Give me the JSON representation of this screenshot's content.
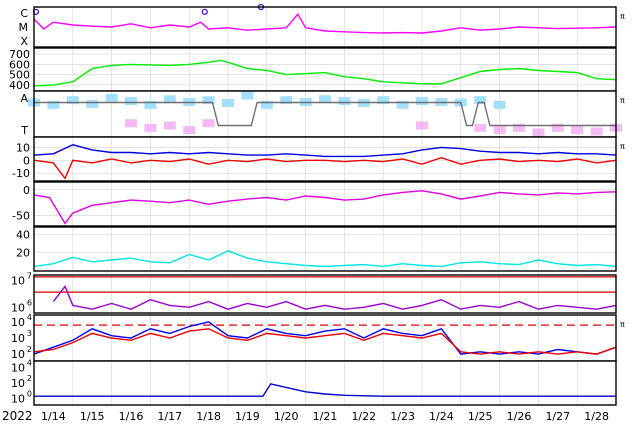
{
  "chart_data": [
    {
      "type": "line",
      "panel": "xray-flux",
      "y_tick_labels": [
        "X",
        "M",
        "C"
      ],
      "right_mark": "π",
      "grid": true,
      "series": [
        {
          "color": "#ff00ff",
          "x": [
            0,
            0.25,
            0.5,
            1,
            1.5,
            2,
            2.5,
            3,
            3.5,
            4,
            4.3,
            4.5,
            5,
            5.5,
            6,
            6.5,
            6.8,
            7,
            7.5,
            8,
            8.5,
            9,
            9.5,
            10,
            10.5,
            11,
            11.5,
            12,
            12.5,
            13,
            13.5,
            14,
            14.5,
            15
          ],
          "y": [
            0.7,
            0.45,
            0.62,
            0.55,
            0.52,
            0.5,
            0.58,
            0.48,
            0.55,
            0.5,
            0.62,
            0.45,
            0.48,
            0.42,
            0.45,
            0.48,
            0.82,
            0.48,
            0.4,
            0.38,
            0.36,
            0.35,
            0.36,
            0.35,
            0.4,
            0.48,
            0.42,
            0.45,
            0.5,
            0.48,
            0.46,
            0.47,
            0.48,
            0.5
          ]
        }
      ],
      "flare_markers": [
        {
          "x": 0.05,
          "y": 0.88
        },
        {
          "x": 4.4,
          "y": 0.88
        },
        {
          "x": 5.85,
          "y": 1.0
        }
      ]
    },
    {
      "type": "line",
      "panel": "solar-wind-speed",
      "y_ticks": [
        400,
        500,
        600,
        700
      ],
      "ylim": [
        340,
        760
      ],
      "grid": true,
      "series": [
        {
          "color": "#00ee00",
          "x": [
            0,
            0.5,
            1,
            1.5,
            2,
            2.5,
            3,
            3.5,
            4,
            4.5,
            4.8,
            5,
            5.5,
            6,
            6.5,
            7,
            7.5,
            8,
            8.5,
            9,
            9.5,
            10,
            10.5,
            11,
            11.5,
            12,
            12.5,
            13,
            13.5,
            14,
            14.5,
            15
          ],
          "y": [
            390,
            400,
            430,
            560,
            590,
            600,
            595,
            590,
            600,
            620,
            640,
            620,
            560,
            540,
            500,
            510,
            520,
            480,
            460,
            430,
            420,
            410,
            410,
            470,
            530,
            550,
            560,
            540,
            530,
            520,
            460,
            450
          ]
        }
      ]
    },
    {
      "type": "scatter",
      "panel": "magnetic-polarity",
      "y_tick_labels": [
        "T",
        "A"
      ],
      "right_mark": "π",
      "grid": true,
      "series": [
        {
          "color": "#99ddff",
          "x": [
            0,
            0.5,
            1,
            1.5,
            2,
            2.5,
            3,
            3.5,
            4,
            4.5,
            5,
            5.5,
            6,
            6.5,
            7,
            7.5,
            8,
            8.5,
            9,
            9.5,
            10,
            10.5,
            11,
            11.5,
            12
          ],
          "y": [
            0.75,
            0.7,
            0.8,
            0.72,
            0.85,
            0.78,
            0.7,
            0.82,
            0.76,
            0.8,
            0.74,
            0.9,
            0.7,
            0.8,
            0.76,
            0.82,
            0.78,
            0.74,
            0.8,
            0.7,
            0.78,
            0.76,
            0.75,
            0.8,
            0.7
          ]
        },
        {
          "color": "#f2b3f2",
          "x": [
            2.5,
            3,
            3.5,
            4,
            4.5,
            10,
            11.5,
            12,
            12.5,
            13,
            13.5,
            14,
            14.5,
            15
          ],
          "y": [
            0.3,
            0.2,
            0.25,
            0.15,
            0.3,
            0.25,
            0.2,
            0.15,
            0.2,
            0.1,
            0.2,
            0.15,
            0.12,
            0.2
          ]
        },
        {
          "color": "#707070",
          "x": [
            0,
            4.6,
            4.75,
            5.6,
            5.75,
            11,
            11.15,
            11.3,
            11.45,
            11.6,
            11.75,
            15
          ],
          "y": [
            0.75,
            0.75,
            0.25,
            0.25,
            0.75,
            0.75,
            0.25,
            0.25,
            0.75,
            0.75,
            0.25,
            0.25
          ]
        }
      ]
    },
    {
      "type": "line",
      "panel": "imf-components",
      "y_ticks": [
        -10,
        0,
        10
      ],
      "ylim": [
        -16,
        18
      ],
      "right_mark": "π",
      "grid": true,
      "series": [
        {
          "color": "#0000dd",
          "x": [
            0,
            0.5,
            1,
            1.5,
            2,
            2.5,
            3,
            3.5,
            4,
            4.5,
            5,
            5.5,
            6,
            6.5,
            7,
            7.5,
            8,
            8.5,
            9,
            9.5,
            10,
            10.5,
            11,
            11.5,
            12,
            12.5,
            13,
            13.5,
            14,
            14.5,
            15
          ],
          "y": [
            4,
            5,
            12,
            8,
            6,
            6,
            5,
            6,
            5,
            6,
            5,
            4,
            4,
            5,
            4,
            3,
            3,
            3,
            4,
            5,
            8,
            10,
            9,
            7,
            6,
            6,
            5,
            6,
            5,
            5,
            4
          ]
        },
        {
          "color": "#ee0000",
          "x": [
            0,
            0.5,
            0.8,
            1,
            1.5,
            2,
            2.5,
            3,
            3.5,
            4,
            4.5,
            5,
            5.5,
            6,
            6.5,
            7,
            7.5,
            8,
            8.5,
            9,
            9.5,
            10,
            10.5,
            11,
            11.5,
            12,
            12.5,
            13,
            13.5,
            14,
            14.5,
            15
          ],
          "y": [
            0,
            -2,
            -14,
            0,
            -2,
            1,
            -2,
            0,
            -1,
            1,
            -3,
            0,
            -1,
            1,
            -1,
            0,
            0,
            -1,
            0,
            -1,
            1,
            -3,
            2,
            -3,
            0,
            1,
            -1,
            0,
            -1,
            1,
            -2,
            0
          ]
        }
      ]
    },
    {
      "type": "line",
      "panel": "dst-index",
      "y_ticks": [
        -50,
        0
      ],
      "ylim": [
        -70,
        15
      ],
      "grid": true,
      "series": [
        {
          "color": "#dd00dd",
          "x": [
            0,
            0.4,
            0.8,
            1,
            1.5,
            2,
            2.5,
            3,
            3.5,
            4,
            4.5,
            5,
            5.5,
            6,
            6.5,
            7,
            7.5,
            8,
            8.5,
            9,
            9.5,
            10,
            10.5,
            11,
            11.5,
            12,
            12.5,
            13,
            13.5,
            14,
            14.5,
            15
          ],
          "y": [
            -10,
            -15,
            -65,
            -45,
            -30,
            -25,
            -20,
            -22,
            -25,
            -20,
            -28,
            -22,
            -18,
            -15,
            -20,
            -12,
            -15,
            -20,
            -18,
            -10,
            -5,
            -2,
            -8,
            -18,
            -12,
            -5,
            -8,
            -10,
            -6,
            -8,
            -5,
            -4
          ]
        }
      ]
    },
    {
      "type": "line",
      "panel": "kp-index",
      "y_ticks": [
        20,
        40
      ],
      "ylim": [
        0,
        48
      ],
      "grid": true,
      "series": [
        {
          "color": "#00e5e5",
          "x": [
            0,
            0.5,
            1,
            1.5,
            2,
            2.5,
            3,
            3.5,
            4,
            4.5,
            5,
            5.5,
            6,
            6.5,
            7,
            7.5,
            8,
            8.5,
            9,
            9.5,
            10,
            10.5,
            11,
            11.5,
            12,
            12.5,
            13,
            13.5,
            14,
            14.5,
            15
          ],
          "y": [
            5,
            8,
            15,
            10,
            12,
            14,
            10,
            9,
            18,
            12,
            22,
            14,
            10,
            8,
            6,
            5,
            6,
            7,
            5,
            8,
            6,
            5,
            9,
            10,
            8,
            7,
            12,
            8,
            6,
            7,
            5
          ]
        }
      ]
    },
    {
      "type": "line",
      "panel": "electron-flux",
      "y_tick_labels": [
        "10",
        "10"
      ],
      "y_tick_exponents": [
        "6",
        "7"
      ],
      "grid": true,
      "threshold_lines": [
        {
          "color": "#cc0000",
          "y": 0.55
        },
        {
          "color": "#cc0000",
          "y": 0.95
        }
      ],
      "series": [
        {
          "color": "#9900cc",
          "x": [
            0.5,
            0.8,
            1,
            1.5,
            2,
            2.5,
            3,
            3.5,
            4,
            4.5,
            5,
            5.5,
            6,
            6.5,
            7,
            7.5,
            8,
            8.5,
            9,
            9.5,
            10,
            10.5,
            11,
            11.5,
            12,
            12.5,
            13,
            13.5,
            14,
            14.5,
            15
          ],
          "y": [
            0.3,
            0.7,
            0.2,
            0.1,
            0.25,
            0.1,
            0.35,
            0.2,
            0.15,
            0.3,
            0.1,
            0.25,
            0.15,
            0.3,
            0.1,
            0.2,
            0.1,
            0.15,
            0.25,
            0.1,
            0.2,
            0.35,
            0.1,
            0.2,
            0.15,
            0.3,
            0.1,
            0.2,
            0.15,
            0.1,
            0.2
          ]
        }
      ]
    },
    {
      "type": "line",
      "panel": "proton-flux",
      "y_tick_labels": [
        "10",
        "10",
        "10"
      ],
      "y_tick_exponents": [
        "2",
        "3",
        "4"
      ],
      "right_mark": "π",
      "grid": true,
      "threshold_lines": [
        {
          "color": "#dd0000",
          "y": 0.78,
          "dashed": true
        }
      ],
      "series": [
        {
          "color": "#0000ee",
          "x": [
            0,
            0.5,
            1,
            1.5,
            2,
            2.5,
            3,
            3.5,
            4,
            4.5,
            5,
            5.5,
            6,
            6.5,
            7,
            7.5,
            8,
            8.5,
            9,
            9.5,
            10,
            10.5,
            11,
            11.5,
            12,
            12.5,
            13,
            13.5,
            14,
            14.5,
            15
          ],
          "y": [
            0.15,
            0.3,
            0.45,
            0.7,
            0.55,
            0.5,
            0.7,
            0.6,
            0.75,
            0.85,
            0.55,
            0.5,
            0.7,
            0.6,
            0.55,
            0.65,
            0.7,
            0.5,
            0.7,
            0.6,
            0.55,
            0.7,
            0.15,
            0.2,
            0.15,
            0.2,
            0.15,
            0.25,
            0.2,
            0.15,
            0.3
          ]
        },
        {
          "color": "#ee0000",
          "x": [
            0,
            0.5,
            1,
            1.5,
            2,
            2.5,
            3,
            3.5,
            4,
            4.5,
            5,
            5.5,
            6,
            6.5,
            7,
            7.5,
            8,
            8.5,
            9,
            9.5,
            10,
            10.5,
            11,
            11.5,
            12,
            12.5,
            13,
            13.5,
            14,
            14.5,
            15
          ],
          "y": [
            0.2,
            0.25,
            0.4,
            0.6,
            0.5,
            0.45,
            0.6,
            0.5,
            0.65,
            0.7,
            0.5,
            0.45,
            0.6,
            0.55,
            0.5,
            0.55,
            0.6,
            0.45,
            0.6,
            0.55,
            0.5,
            0.6,
            0.2,
            0.15,
            0.2,
            0.15,
            0.2,
            0.15,
            0.2,
            0.15,
            0.3
          ]
        }
      ]
    },
    {
      "type": "line",
      "panel": "particle-flux",
      "y_tick_labels": [
        "10",
        "10",
        "10"
      ],
      "y_tick_exponents": [
        "0",
        "2",
        "4"
      ],
      "grid": true,
      "series": [
        {
          "color": "#0000cc",
          "x": [
            0,
            1,
            2,
            3,
            4,
            5,
            5.9,
            6.1,
            6.5,
            7,
            7.5,
            8,
            9,
            10,
            11,
            12,
            13,
            14,
            15
          ],
          "y": [
            0.2,
            0.2,
            0.2,
            0.2,
            0.2,
            0.2,
            0.2,
            0.48,
            0.4,
            0.3,
            0.25,
            0.22,
            0.2,
            0.2,
            0.2,
            0.2,
            0.2,
            0.2,
            0.2
          ]
        }
      ]
    }
  ],
  "x_axis": {
    "year_label": "2022",
    "tick_labels": [
      "1/14",
      "1/15",
      "1/16",
      "1/17",
      "1/18",
      "1/19",
      "1/20",
      "1/21",
      "1/22",
      "1/23",
      "1/24",
      "1/25",
      "1/26",
      "1/27",
      "1/28"
    ]
  }
}
